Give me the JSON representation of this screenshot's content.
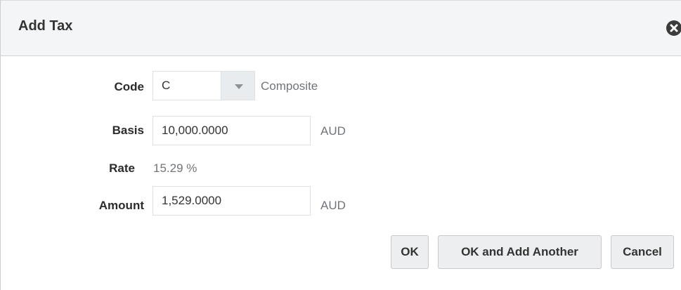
{
  "dialog": {
    "title": "Add Tax"
  },
  "form": {
    "code": {
      "label": "Code",
      "value": "C",
      "description": "Composite"
    },
    "basis": {
      "label": "Basis",
      "value": "10,000.0000",
      "currency": "AUD"
    },
    "rate": {
      "label": "Rate",
      "value": "15.29 %"
    },
    "amount": {
      "label": "Amount",
      "value": "1,529.0000",
      "currency": "AUD"
    }
  },
  "buttons": {
    "ok": "OK",
    "ok_add_another": "OK and Add Another",
    "cancel": "Cancel"
  },
  "icons": {
    "close": "close-icon",
    "dropdown": "chevron-down-icon"
  }
}
